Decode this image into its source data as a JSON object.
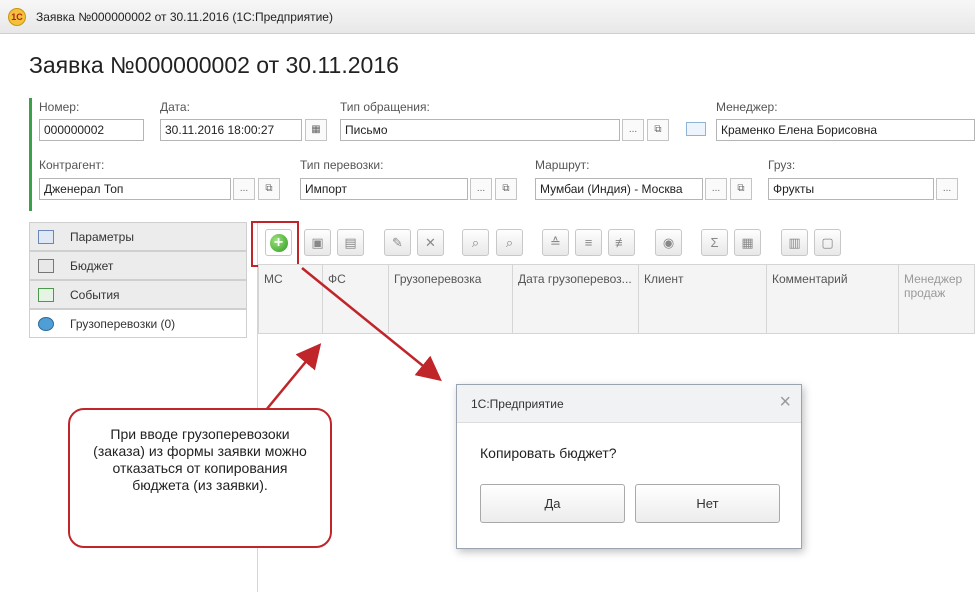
{
  "window": {
    "title": "Заявка №000000002 от 30.11.2016  (1С:Предприятие)",
    "logo": "1С"
  },
  "page": {
    "title": "Заявка №000000002 от 30.11.2016"
  },
  "form": {
    "number_label": "Номер:",
    "number_value": "000000002",
    "date_label": "Дата:",
    "date_value": "30.11.2016 18:00:27",
    "appeal_type_label": "Тип обращения:",
    "appeal_type_value": "Письмо",
    "manager_label": "Менеджер:",
    "manager_value": "Краменко Елена Борисовна",
    "counterparty_label": "Контрагент:",
    "counterparty_value": "Дженерал Топ",
    "transport_type_label": "Тип перевозки:",
    "transport_type_value": "Импорт",
    "route_label": "Маршрут:",
    "route_value": "Мумбаи (Индия) - Москва",
    "cargo_label": "Груз:",
    "cargo_value": "Фрукты",
    "select_glyph": "...",
    "open_glyph": "⧉",
    "calendar_glyph": "▦"
  },
  "sidebar": {
    "items": [
      {
        "label": "Параметры",
        "icon": "parameters-icon"
      },
      {
        "label": "Бюджет",
        "icon": "budget-icon"
      },
      {
        "label": "События",
        "icon": "events-icon"
      },
      {
        "label": "Грузоперевозки (0)",
        "icon": "globe-icon"
      }
    ]
  },
  "toolbar": {
    "add_glyph": "+",
    "buttons": [
      "add-icon",
      "add-copy-icon",
      "copy-icon",
      "edit-icon",
      "delete-icon",
      "find-icon",
      "cancel-search-icon",
      "sort-asc-icon",
      "filter-icon",
      "clear-filter-icon",
      "palette-icon",
      "sum-icon",
      "report-icon",
      "export-icon",
      "folder-icon"
    ]
  },
  "table": {
    "columns": [
      "МС",
      "ФС",
      "Грузоперевозка",
      "Дата грузоперевоз...",
      "Клиент",
      "Комментарий",
      "Менеджер продаж"
    ]
  },
  "callout": {
    "text": "При вводе грузоперевозоки (заказа) из формы заявки можно отказаться от копирования бюджета (из заявки)."
  },
  "dialog": {
    "title": "1С:Предприятие",
    "close_glyph": "×",
    "message": "Копировать бюджет?",
    "yes_label": "Да",
    "no_label": "Нет"
  },
  "colors": {
    "accent_red": "#c0252a",
    "green_bar": "#3aa04a"
  }
}
